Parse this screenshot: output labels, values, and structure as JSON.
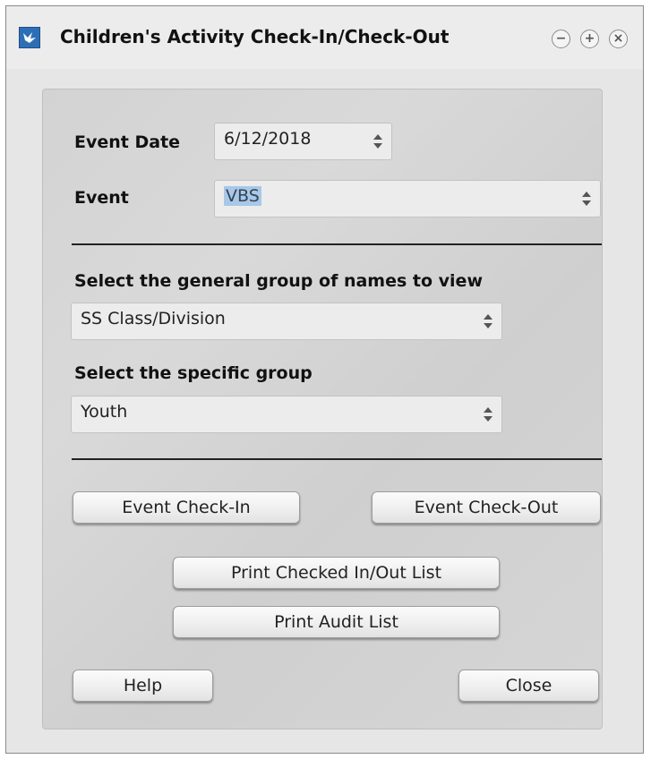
{
  "window": {
    "title": "Children's Activity Check-In/Check-Out",
    "controls": {
      "minimize": "−",
      "maximize": "+",
      "close": "×"
    }
  },
  "form": {
    "event_date": {
      "label": "Event Date",
      "value": "6/12/2018"
    },
    "event": {
      "label": "Event",
      "value": "VBS"
    },
    "general_group": {
      "label": "Select the general group of names to view",
      "value": "SS Class/Division"
    },
    "specific_group": {
      "label": "Select the specific group",
      "value": "Youth"
    }
  },
  "buttons": {
    "check_in": "Event Check-In",
    "check_out": "Event Check-Out",
    "print_list": "Print Checked In/Out List",
    "print_audit": "Print Audit List",
    "help": "Help",
    "close": "Close"
  }
}
